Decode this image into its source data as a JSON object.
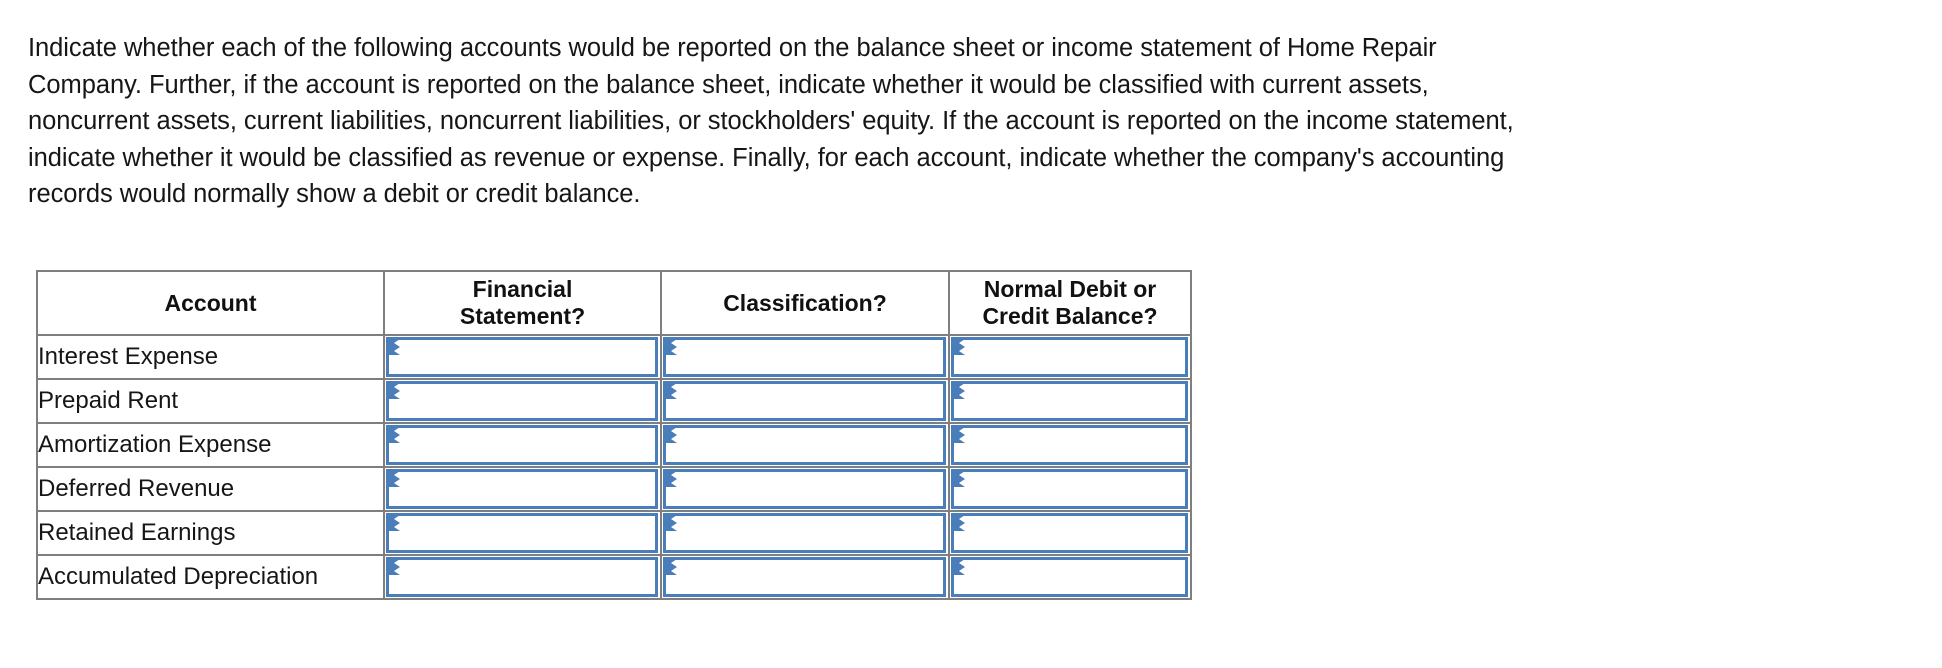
{
  "instructions": {
    "lines": [
      "Indicate whether each of the following accounts would be reported on the balance sheet or income statement of Home Repair",
      "Company. Further, if the account is reported on the balance sheet, indicate whether it would be classified with current assets,",
      "noncurrent assets, current liabilities, noncurrent liabilities, or stockholders' equity. If the account is reported on the income statement,",
      "indicate whether it would be classified as revenue or expense. Finally, for each account, indicate whether the company's accounting",
      "records would normally show a debit or credit balance."
    ]
  },
  "table": {
    "headers": [
      {
        "lines": [
          "Account"
        ]
      },
      {
        "lines": [
          "Financial",
          "Statement?"
        ]
      },
      {
        "lines": [
          "Classification?"
        ]
      },
      {
        "lines": [
          "Normal Debit or",
          "Credit Balance?"
        ]
      }
    ],
    "rows": [
      {
        "account": "Interest Expense",
        "financial_statement": "",
        "classification": "",
        "normal_balance": ""
      },
      {
        "account": "Prepaid Rent",
        "financial_statement": "",
        "classification": "",
        "normal_balance": ""
      },
      {
        "account": "Amortization Expense",
        "financial_statement": "",
        "classification": "",
        "normal_balance": ""
      },
      {
        "account": "Deferred Revenue",
        "financial_statement": "",
        "classification": "",
        "normal_balance": ""
      },
      {
        "account": "Retained Earnings",
        "financial_statement": "",
        "classification": "",
        "normal_balance": ""
      },
      {
        "account": "Accumulated Depreciation",
        "financial_statement": "",
        "classification": "",
        "normal_balance": ""
      }
    ]
  },
  "colors": {
    "header_background": "#81ABE3",
    "dropdown_border": "#4A7EBB",
    "cell_border": "#7F7F7F",
    "text": "#161616",
    "page_background": "#FFFFFF"
  },
  "icons": {
    "dropdown_arrow": "triangle-right-icon"
  }
}
